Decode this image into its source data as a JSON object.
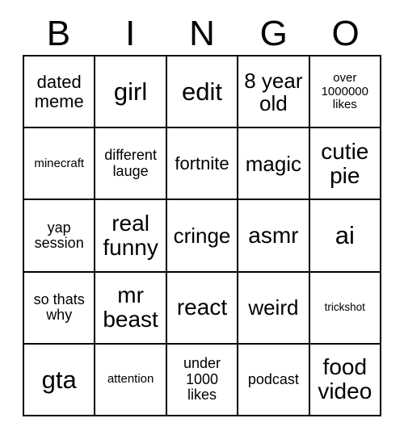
{
  "card": {
    "header": {
      "letters": [
        "B",
        "I",
        "N",
        "G",
        "O"
      ]
    },
    "colors": {
      "border": "#000000",
      "cell_background": "#ffffff",
      "text": "#000000",
      "page_background": "#ffffff"
    },
    "grid": {
      "columns": 5,
      "rows": 5,
      "cells": [
        [
          {
            "text": "dated meme",
            "size": "md"
          },
          {
            "text": "girl",
            "size": "xxl"
          },
          {
            "text": "edit",
            "size": "xxl"
          },
          {
            "text": "8 year old",
            "size": "lg"
          },
          {
            "text": "over 1000000 likes",
            "size": "xs"
          }
        ],
        [
          {
            "text": "minecraft",
            "size": "xs"
          },
          {
            "text": "different lauge",
            "size": "sm"
          },
          {
            "text": "fortnite",
            "size": "md"
          },
          {
            "text": "magic",
            "size": "lg"
          },
          {
            "text": "cutie pie",
            "size": "xl"
          }
        ],
        [
          {
            "text": "yap session",
            "size": "sm"
          },
          {
            "text": "real funny",
            "size": "xl"
          },
          {
            "text": "cringe",
            "size": "lg"
          },
          {
            "text": "asmr",
            "size": "xl"
          },
          {
            "text": "ai",
            "size": "xxl"
          }
        ],
        [
          {
            "text": "so thats why",
            "size": "sm"
          },
          {
            "text": "mr beast",
            "size": "xl"
          },
          {
            "text": "react",
            "size": "xl"
          },
          {
            "text": "weird",
            "size": "lg"
          },
          {
            "text": "trickshot",
            "size": "xxs"
          }
        ],
        [
          {
            "text": "gta",
            "size": "xxl"
          },
          {
            "text": "attention",
            "size": "xs"
          },
          {
            "text": "under 1000 likes",
            "size": "sm"
          },
          {
            "text": "podcast",
            "size": "sm"
          },
          {
            "text": "food video",
            "size": "xl"
          }
        ]
      ]
    }
  }
}
